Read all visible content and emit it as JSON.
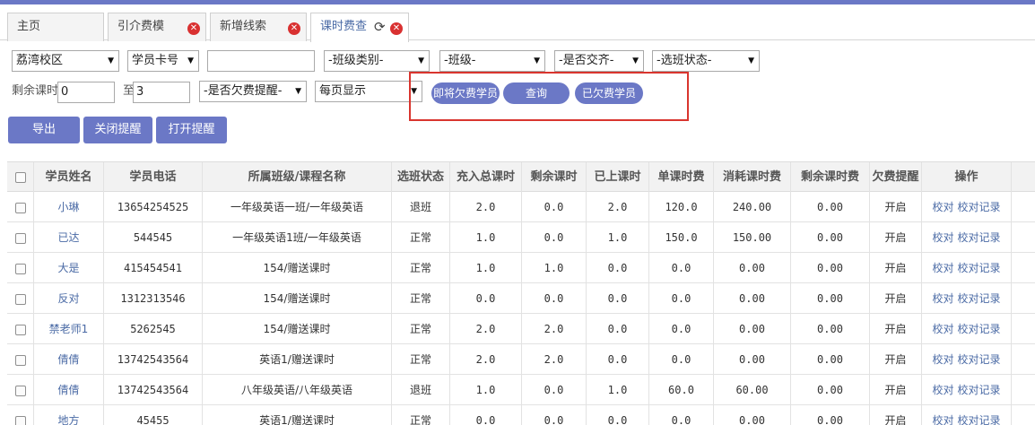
{
  "tabs": [
    {
      "label": "主页"
    },
    {
      "label": "引介费模"
    },
    {
      "label": "新增线索"
    },
    {
      "label": "课时费查"
    }
  ],
  "filters": {
    "campus": "荔湾校区",
    "card_type": "学员卡号",
    "card_value": "",
    "class_type": "-班级类别-",
    "class": "-班级-",
    "paid": "-是否交齐-",
    "status": "-选班状态-",
    "remaining_label": "剩余课时",
    "remaining_from": "0",
    "to_label": "至",
    "remaining_to": "3",
    "arrears_remind": "-是否欠费提醒-",
    "page_size": "每页显示"
  },
  "pills": {
    "upcoming": "即将欠费学员",
    "query": "查询",
    "owing": "已欠费学员"
  },
  "actions": {
    "export": "导出",
    "close_remind": "关闭提醒",
    "open_remind": "打开提醒"
  },
  "table": {
    "headers": [
      "学员姓名",
      "学员电话",
      "所属班级/课程名称",
      "选班状态",
      "充入总课时",
      "剩余课时",
      "已上课时",
      "单课时费",
      "消耗课时费",
      "剩余课时费",
      "欠费提醒",
      "操作"
    ],
    "op_check": "校对",
    "op_record": "校对记录",
    "rows": [
      {
        "name": "小琳",
        "phone": "13654254525",
        "course": "一年级英语一班/一年级英语",
        "status": "退班",
        "total": "2.0",
        "remain": "0.0",
        "used": "2.0",
        "unit": "120.0",
        "consumed": "240.00",
        "remain_fee": "0.00",
        "remind": "开启"
      },
      {
        "name": "已达",
        "phone": "544545",
        "course": "一年级英语1班/一年级英语",
        "status": "正常",
        "total": "1.0",
        "remain": "0.0",
        "used": "1.0",
        "unit": "150.0",
        "consumed": "150.00",
        "remain_fee": "0.00",
        "remind": "开启"
      },
      {
        "name": "大是",
        "phone": "415454541",
        "course": "154/赠送课时",
        "status": "正常",
        "total": "1.0",
        "remain": "1.0",
        "used": "0.0",
        "unit": "0.0",
        "consumed": "0.00",
        "remain_fee": "0.00",
        "remind": "开启"
      },
      {
        "name": "反对",
        "phone": "1312313546",
        "course": "154/赠送课时",
        "status": "正常",
        "total": "0.0",
        "remain": "0.0",
        "used": "0.0",
        "unit": "0.0",
        "consumed": "0.00",
        "remain_fee": "0.00",
        "remind": "开启"
      },
      {
        "name": "禁老师1",
        "phone": "5262545",
        "course": "154/赠送课时",
        "status": "正常",
        "total": "2.0",
        "remain": "2.0",
        "used": "0.0",
        "unit": "0.0",
        "consumed": "0.00",
        "remain_fee": "0.00",
        "remind": "开启"
      },
      {
        "name": "倩倩",
        "phone": "13742543564",
        "course": "英语1/赠送课时",
        "status": "正常",
        "total": "2.0",
        "remain": "2.0",
        "used": "0.0",
        "unit": "0.0",
        "consumed": "0.00",
        "remain_fee": "0.00",
        "remind": "开启"
      },
      {
        "name": "倩倩",
        "phone": "13742543564",
        "course": "八年级英语/八年级英语",
        "status": "退班",
        "total": "1.0",
        "remain": "0.0",
        "used": "1.0",
        "unit": "60.0",
        "consumed": "60.00",
        "remain_fee": "0.00",
        "remind": "开启"
      },
      {
        "name": "地方",
        "phone": "45455",
        "course": "英语1/赠送课时",
        "status": "正常",
        "total": "0.0",
        "remain": "0.0",
        "used": "0.0",
        "unit": "0.0",
        "consumed": "0.00",
        "remain_fee": "0.00",
        "remind": "开启"
      }
    ]
  },
  "colors": {
    "accent": "#6b78c6",
    "highlight_box": "#d9352e",
    "link": "#4a6aa5"
  }
}
